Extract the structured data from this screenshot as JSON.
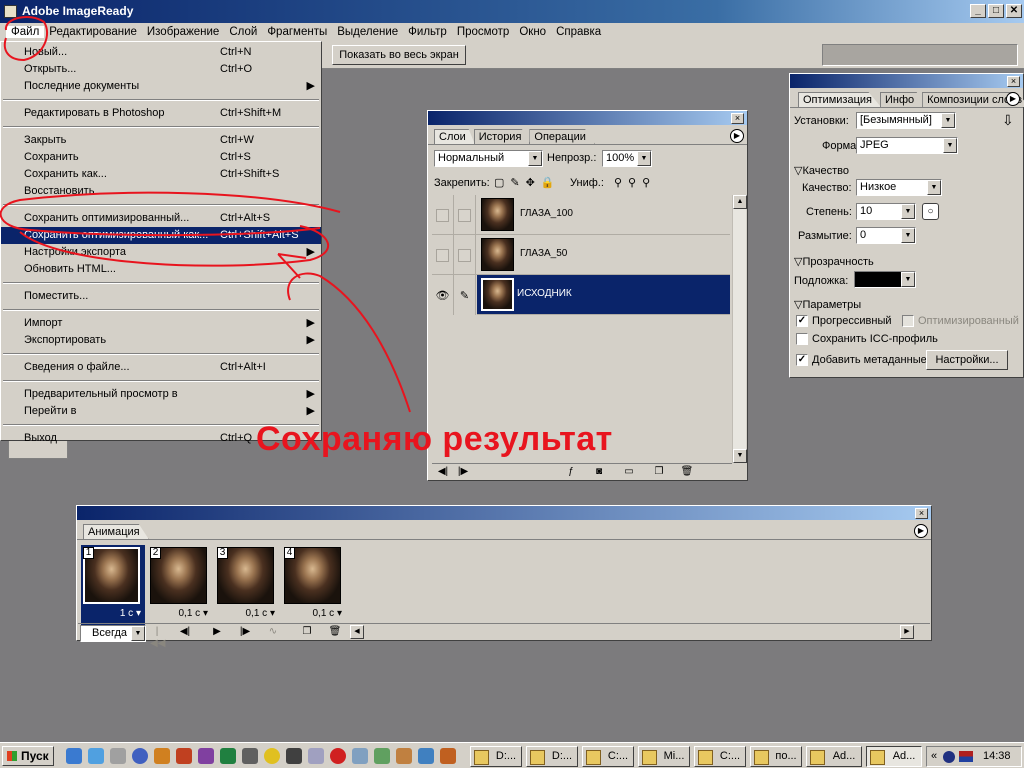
{
  "window": {
    "title": "Adobe ImageReady",
    "minimize": "_",
    "maximize": "□",
    "close": "✕"
  },
  "menubar": [
    "Файл",
    "Редактирование",
    "Изображение",
    "Слой",
    "Фрагменты",
    "Выделение",
    "Фильтр",
    "Просмотр",
    "Окно",
    "Справка"
  ],
  "toolbar": {
    "fit_button": "Показать во весь экран"
  },
  "file_menu": {
    "groups": [
      [
        {
          "label": "Новый...",
          "shortcut": "Ctrl+N"
        },
        {
          "label": "Открыть...",
          "shortcut": "Ctrl+O"
        },
        {
          "label": "Последние документы",
          "shortcut": "",
          "submenu": true
        }
      ],
      [
        {
          "label": "Редактировать в Photoshop",
          "shortcut": "Ctrl+Shift+M"
        }
      ],
      [
        {
          "label": "Закрыть",
          "shortcut": "Ctrl+W"
        },
        {
          "label": "Сохранить",
          "shortcut": "Ctrl+S"
        },
        {
          "label": "Сохранить как...",
          "shortcut": "Ctrl+Shift+S"
        },
        {
          "label": "Восстановить",
          "shortcut": ""
        }
      ],
      [
        {
          "label": "Сохранить оптимизированный...",
          "shortcut": "Ctrl+Alt+S"
        },
        {
          "label": "Сохранить оптимизированный как...",
          "shortcut": "Ctrl+Shift+Alt+S",
          "highlighted": true
        },
        {
          "label": "Настройки экспорта",
          "shortcut": "",
          "submenu": true
        },
        {
          "label": "Обновить HTML...",
          "shortcut": ""
        }
      ],
      [
        {
          "label": "Поместить...",
          "shortcut": ""
        }
      ],
      [
        {
          "label": "Импорт",
          "shortcut": "",
          "submenu": true
        },
        {
          "label": "Экспортировать",
          "shortcut": "",
          "submenu": true
        }
      ],
      [
        {
          "label": "Сведения о файле...",
          "shortcut": "Ctrl+Alt+I"
        }
      ],
      [
        {
          "label": "Предварительный просмотр в",
          "shortcut": "",
          "submenu": true
        },
        {
          "label": "Перейти в",
          "shortcut": "",
          "submenu": true
        }
      ],
      [
        {
          "label": "Выход",
          "shortcut": "Ctrl+Q"
        }
      ]
    ]
  },
  "layers_panel": {
    "tabs": [
      "Слои",
      "История",
      "Операции"
    ],
    "blend_mode": "Нормальный",
    "opacity_label": "Непрозр.:",
    "opacity": "100%",
    "lock_label": "Закрепить:",
    "unify_label": "Униф.:",
    "layers": [
      {
        "name": "ГЛАЗА_100",
        "visible": false,
        "active": false
      },
      {
        "name": "ГЛАЗА_50",
        "visible": false,
        "active": false
      },
      {
        "name": "ИСХОДНИК",
        "visible": true,
        "active": true
      }
    ]
  },
  "optimize_panel": {
    "tabs": [
      "Оптимизация",
      "Инфо",
      "Композиции слоев"
    ],
    "preset_label": "Установки:",
    "preset": "[Безымянный]",
    "format_label": "Формат:",
    "format": "JPEG",
    "quality_section": "Качество",
    "quality_label": "Качество:",
    "quality": "Низкое",
    "amount_label": "Степень:",
    "amount": "10",
    "blur_label": "Размытие:",
    "blur": "0",
    "transparency_section": "Прозрачность",
    "matte_label": "Подложка:",
    "params_section": "Параметры",
    "progressive": {
      "label": "Прогрессивный",
      "checked": true
    },
    "optimized": {
      "label": "Оптимизированный",
      "checked": false
    },
    "icc": {
      "label": "Сохранить ICC-профиль",
      "checked": false
    },
    "metadata": {
      "label": "Добавить метаданные",
      "checked": true
    },
    "settings_button": "Настройки..."
  },
  "animation_panel": {
    "tab": "Анимация",
    "frames": [
      {
        "num": "1",
        "delay": "1 с"
      },
      {
        "num": "2",
        "delay": "0,1 с"
      },
      {
        "num": "3",
        "delay": "0,1 с"
      },
      {
        "num": "4",
        "delay": "0,1 с"
      }
    ],
    "loop": "Всегда"
  },
  "annotation": {
    "text": "Сохраняю результат",
    "color": "#e8141e"
  },
  "taskbar": {
    "start": "Пуск",
    "tasks": [
      "D:...",
      "D:...",
      "C:...",
      "Mi...",
      "C:...",
      "по...",
      "Ad...",
      "Ad..."
    ],
    "time": "14:38",
    "tray_arrow": "«"
  },
  "colors": {
    "titlebar": "#0a246a",
    "selection": "#0a246a",
    "chrome": "#d4d0c8",
    "workspace": "#7c7b7d"
  }
}
